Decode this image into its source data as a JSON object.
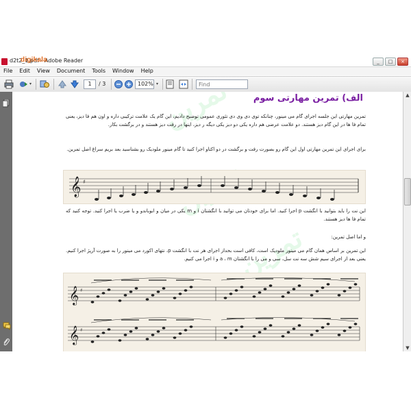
{
  "window": {
    "title": "d2t2_1.pdf - Adobe Reader",
    "watermark_logo": "digikala",
    "controls": {
      "minimize": "_",
      "maximize": "□",
      "close": "×"
    }
  },
  "menu": [
    "File",
    "Edit",
    "View",
    "Document",
    "Tools",
    "Window",
    "Help"
  ],
  "toolbar": {
    "current_page": "1",
    "total_pages": "/ 3",
    "zoom": "102%",
    "find_placeholder": "Find"
  },
  "document": {
    "heading": "الف) تمرین مهارتی سوم",
    "para1": "تمرین مهارتی این جلسه اجرای گام می مینور، چنانکه توی دی وی دی تئوری عمومی توضیح دادیم، این گام یک علامت ترکیبی داره و اون هم فا دیز، یعنی تمام فا ها در این گام دیز هستند. دو علامت عرضی هم داره یکی دو دیز یکی دیگه ر دیز، اینها در رفت دیز هستند و در برگشت بکار.",
    "para2": "برای اجرای این تمرین مهارتی اول این گام رو بصورت رفت و برگشت در دو اکتاو اجرا کنید تا گام مینور ملودیک رو بشناسید بعد بریم سراغ اصل تمرین.",
    "para3": "این نت را باید بتوانید با انگشت p اجرا کنید. اما برای خودتان می توانید با انگشتان i و m یکی در میان و ابوباندو و یا ضرب یا اجرا کنید. توجه کنید که تمام فا ها دیز هستند.",
    "para4": "و اما اصل تمرین:",
    "para5": "این تمرین بر اساس همان گام می مینور ملودیک است، کافی است بحداز اجرای هر نت با انگشت p، نتهای اکورد می مینور را به صورت آرپژ اجرا کنیم. یعنی بعد از اجرای سیم شش سه نت سل، سی و می را با انگشتان a ، m و i اجرا می کنیم.",
    "watermark_text": "تمرین"
  }
}
